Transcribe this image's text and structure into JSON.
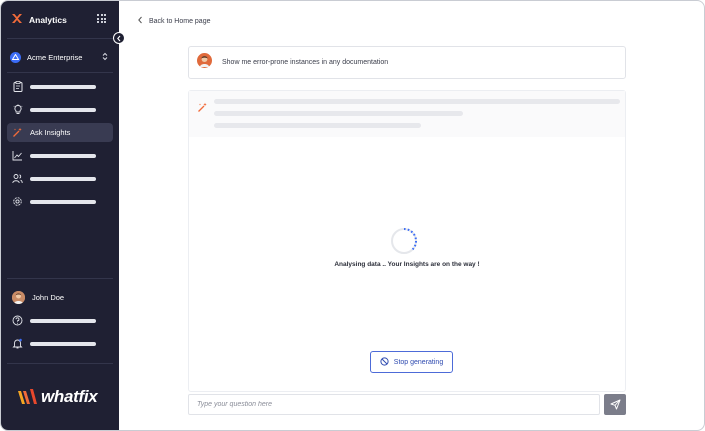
{
  "sidebar": {
    "app_title": "Analytics",
    "org_name": "Acme Enterprise",
    "active_item_label": "Ask Insights",
    "user_name": "John Doe",
    "logo_text": "whatfix"
  },
  "main": {
    "back_link": "Back to Home page",
    "query_text": "Show me error-prone instances in any documentation",
    "loading_text": "Analysing data .. Your Insights are on the way !",
    "stop_button_label": "Stop generating",
    "question_placeholder": "Type your question here"
  },
  "icons": {
    "brand": "whatfix-x-icon",
    "apps": "grid-icon",
    "org": "org-avatar-icon",
    "switch": "chevron-updown-icon",
    "nav": [
      "clipboard-icon",
      "lightbulb-icon",
      "sparkle-wand-icon",
      "chart-icon",
      "users-icon",
      "gear-icon"
    ],
    "help": "help-circle-icon",
    "notifications": "bell-icon",
    "stop": "ban-icon",
    "send": "send-icon"
  },
  "colors": {
    "sidebar_bg": "#1f2033",
    "brand_orange": "#f26b3a",
    "accent_blue": "#3b6cf6",
    "stop_button_border": "#4d6bd8",
    "send_button_bg": "#7b7d8a"
  }
}
